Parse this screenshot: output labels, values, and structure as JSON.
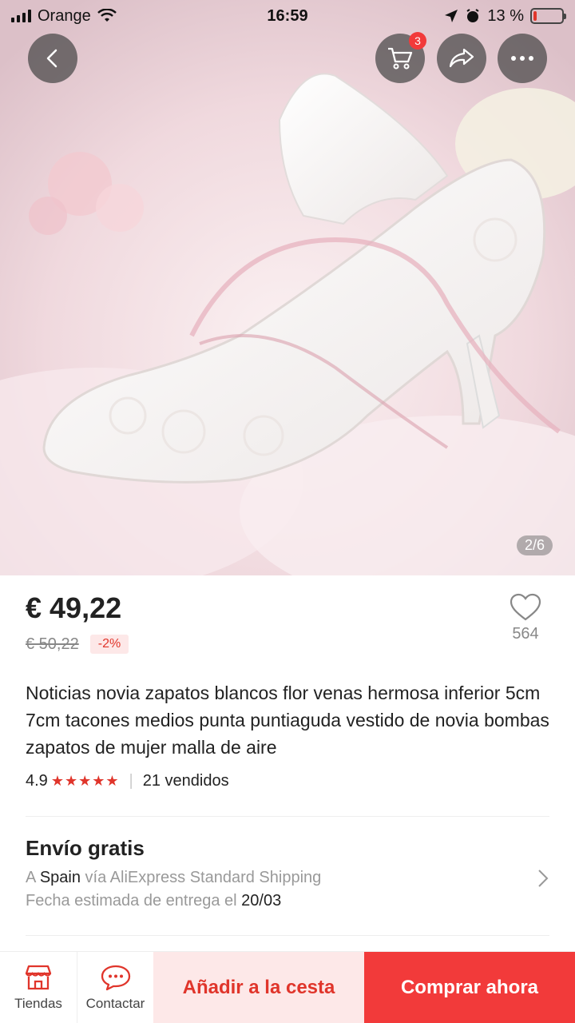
{
  "status_bar": {
    "carrier": "Orange",
    "time": "16:59",
    "battery": "13 %",
    "battery_level": 0.13
  },
  "header": {
    "cart_count": "3",
    "icons": [
      "back-icon",
      "cart-icon",
      "share-icon",
      "more-icon"
    ]
  },
  "gallery": {
    "counter": "2/6"
  },
  "product": {
    "price": "€ 49,22",
    "old_price": "€ 50,22",
    "discount": "-2%",
    "wishlist_count": "564",
    "title": "Noticias novia zapatos blancos flor venas hermosa inferior 5cm 7cm tacones medios punta puntiaguda vestido de novia bombas zapatos de mujer malla de aire",
    "rating": "4.9",
    "stars": "★★★★★",
    "sold": "21 vendidos"
  },
  "shipping": {
    "title": "Envío gratis",
    "to_prefix": "A",
    "country": "Spain",
    "method": "vía AliExpress Standard Shipping",
    "eta_prefix": "Fecha estimada de entrega el",
    "eta_date": "20/03"
  },
  "bottom_bar": {
    "stores": "Tiendas",
    "contact": "Contactar",
    "add_to_cart": "Añadir a la cesta",
    "buy_now": "Comprar ahora"
  },
  "colors": {
    "accent": "#f23a3a",
    "accent_light": "#fde8e8"
  }
}
